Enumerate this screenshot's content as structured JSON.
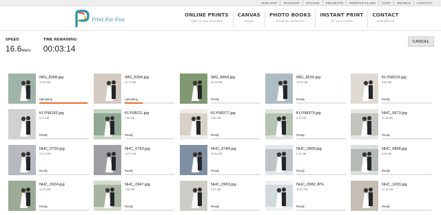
{
  "topbar": {
    "links": [
      "SIGN OUT",
      "ACCOUNT",
      "UPLOAD",
      "PROJECTS",
      "PREPAID PLANS",
      "CART",
      "SEARCH",
      "CONTACT"
    ]
  },
  "logo": {
    "text": "Print For Fun"
  },
  "nav": [
    {
      "title": "ONLINE PRINTS",
      "sub": "right to your doorstep"
    },
    {
      "title": "CANVAS",
      "sub": "unique"
    },
    {
      "title": "PHOTO BOOKS",
      "sub": "preserve memories"
    },
    {
      "title": "INSTANT PRINT",
      "sub": "for your events"
    },
    {
      "title": "CONTACT",
      "sub": "email/phone"
    }
  ],
  "stats": {
    "speed_label": "SPEED",
    "speed_value": "16.6",
    "speed_unit": "Mbit/s",
    "time_label": "TIME REMAINING",
    "time_value": "00:03:14"
  },
  "cancel_label": "CANCEL",
  "colors": {
    "progress": "#e8692c",
    "track": "#e3e3e3"
  },
  "files": [
    {
      "name": "IMG_8288.jpg",
      "size": "12.09 MB",
      "status": "Uploading",
      "progress": 0.97
    },
    {
      "name": "IMG_8394.jpg",
      "size": "12.72 MB",
      "status": "Uploading",
      "progress": 0.36
    },
    {
      "name": "IMG_8464.jpg",
      "size": "20.16 MB",
      "status": "Ready",
      "progress": 0
    },
    {
      "name": "IMG_8539.jpg",
      "size": "19.42 MB",
      "status": "Ready",
      "progress": 0
    },
    {
      "name": "KLYN8103.jpg",
      "size": "6.65 MB",
      "status": "Ready",
      "progress": 0
    },
    {
      "name": "KLYN8183.jpg",
      "size": "5.23 MB",
      "status": "Ready",
      "progress": 0
    },
    {
      "name": "KLYN8211.jpg",
      "size": "7.86 MB",
      "status": "Ready",
      "progress": 0
    },
    {
      "name": "KLYN8377.jpg",
      "size": "4.50 MB",
      "status": "Ready",
      "progress": 0
    },
    {
      "name": "KLYN8379.jpg",
      "size": "4.70 MB",
      "status": "Ready",
      "progress": 0
    },
    {
      "name": "NHC_0673.jpg",
      "size": "11.44 MB",
      "status": "Ready",
      "progress": 0
    },
    {
      "name": "NHC_0759.jpg",
      "size": "13.22 MB",
      "status": "Ready",
      "progress": 0
    },
    {
      "name": "NHC_0763.jpg",
      "size": "14.97 MB",
      "status": "Ready",
      "progress": 0
    },
    {
      "name": "NHC_0784.jpg",
      "size": "10.36 MB",
      "status": "Ready",
      "progress": 0
    },
    {
      "name": "NHC_0809.jpg",
      "size": "8.13 MB",
      "status": "Ready",
      "progress": 0
    },
    {
      "name": "NHC_0868.jpg",
      "size": "6.06 MB",
      "status": "Ready",
      "progress": 0
    },
    {
      "name": "NHC_0924.jpg",
      "size": "12.29 MB",
      "status": "Ready",
      "progress": 0
    },
    {
      "name": "NHC_0947.jpg",
      "size": "7.88 MB",
      "status": "Ready",
      "progress": 0
    },
    {
      "name": "NHC_0963.jpg",
      "size": "9.07 MB",
      "status": "Ready",
      "progress": 0
    },
    {
      "name": "NHC_0982.JPG",
      "size": "10.87 MB",
      "status": "Ready",
      "progress": 0
    },
    {
      "name": "NHC_1003.jpg",
      "size": "12.15 MB",
      "status": "Ready",
      "progress": 0
    }
  ]
}
